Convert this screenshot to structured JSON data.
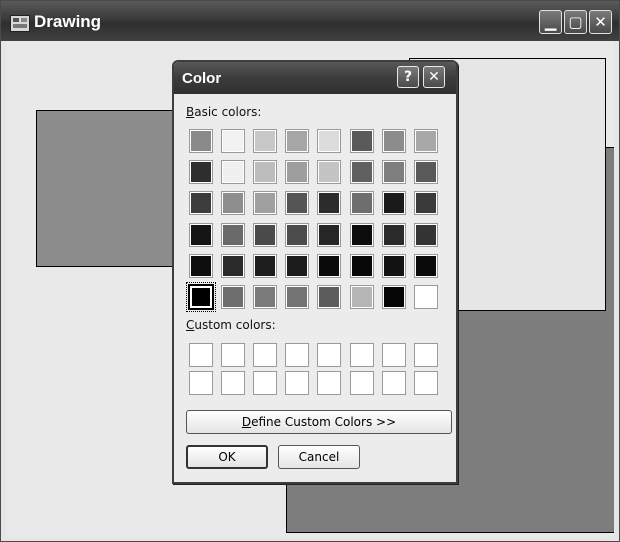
{
  "window": {
    "title": "Drawing",
    "minimize_glyph": "▁",
    "maximize_glyph": "▢",
    "close_glyph": "✕"
  },
  "dialog": {
    "title": "Color",
    "help_glyph": "?",
    "close_glyph": "✕",
    "basic_colors_label_mnemonic": "B",
    "basic_colors_label_rest": "asic colors:",
    "custom_colors_label_mnemonic": "C",
    "custom_colors_label_rest": "ustom colors:",
    "define_button_mnemonic": "D",
    "define_button_rest": "efine Custom Colors >>",
    "ok_label": "OK",
    "cancel_label": "Cancel",
    "selected_basic_index": 40,
    "basic_colors": [
      "#8a8a8a",
      "#f2f2f2",
      "#c8c8c8",
      "#a6a6a6",
      "#dcdcdc",
      "#5a5a5a",
      "#8c8c8c",
      "#a8a8a8",
      "#2e2e2e",
      "#f0f0f0",
      "#bdbdbd",
      "#9e9e9e",
      "#c4c4c4",
      "#606060",
      "#7e7e7e",
      "#595959",
      "#3c3c3c",
      "#8e8e8e",
      "#a0a0a0",
      "#555555",
      "#2c2c2c",
      "#6e6e6e",
      "#1a1a1a",
      "#3a3a3a",
      "#141414",
      "#6a6a6a",
      "#4a4a4a",
      "#4c4c4c",
      "#262626",
      "#0c0c0c",
      "#2a2a2a",
      "#333333",
      "#0e0e0e",
      "#2a2a2a",
      "#1e1e1e",
      "#1c1c1c",
      "#0a0a0a",
      "#080808",
      "#121212",
      "#0a0a0a",
      "#000000",
      "#6e6e6e",
      "#7a7a7a",
      "#737373",
      "#5c5c5c",
      "#b5b5b5",
      "#050505",
      "#ffffff"
    ],
    "custom_colors": [
      "#ffffff",
      "#ffffff",
      "#ffffff",
      "#ffffff",
      "#ffffff",
      "#ffffff",
      "#ffffff",
      "#ffffff",
      "#ffffff",
      "#ffffff",
      "#ffffff",
      "#ffffff",
      "#ffffff",
      "#ffffff",
      "#ffffff",
      "#ffffff"
    ]
  }
}
